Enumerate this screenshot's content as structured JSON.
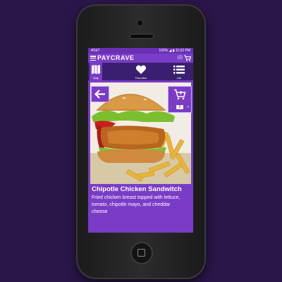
{
  "status_bar": {
    "carrier": "AT&T",
    "battery": "100%",
    "time": "11:02 PM"
  },
  "app_bar": {
    "brand": "PAYCRAVE",
    "cart_count": "(2)"
  },
  "tabs": [
    {
      "label": "Map",
      "icon": "map-icon"
    },
    {
      "label": "Favorites",
      "icon": "heart-icon"
    },
    {
      "label": "List",
      "icon": "list-icon"
    }
  ],
  "item": {
    "title": "Chipotle Chicken Sandwitch",
    "description": "Fried chicken breast topped with lettuce, tomato, chipotle mayo, and cheddar cheese",
    "quantity": "0",
    "minus": "-",
    "plus": "+"
  },
  "colors": {
    "accent": "#7a3cc6",
    "tab_bar": "#3a1f70",
    "background": "#2a1648"
  }
}
